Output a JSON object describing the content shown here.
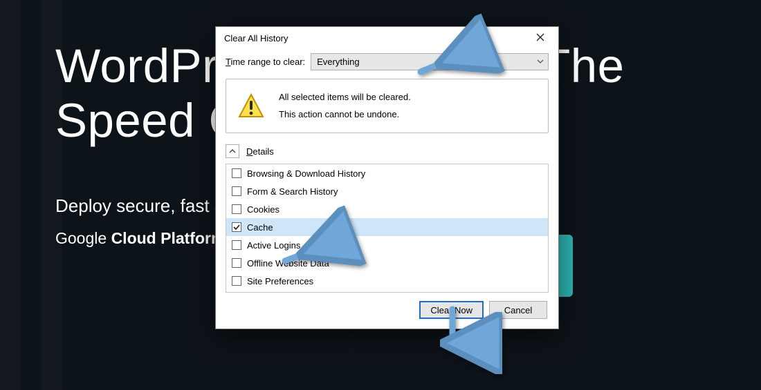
{
  "hero": {
    "title": "WordPress Hosting At The Speed Of",
    "subtitle": "Deploy secure, fast and reliable WordPress hosting",
    "platform_prefix": "Google",
    "platform_bold": "Cloud Platform"
  },
  "dialog": {
    "title": "Clear All History",
    "range_label_pre": "T",
    "range_label_rest": "ime range to clear:",
    "range_value": "Everything",
    "warn_line1": "All selected items will be cleared.",
    "warn_line2": "This action cannot be undone.",
    "details_pre": "D",
    "details_rest": "etails",
    "options": [
      {
        "label": "Browsing & Download History",
        "checked": false,
        "selected": false
      },
      {
        "label": "Form & Search History",
        "checked": false,
        "selected": false
      },
      {
        "label": "Cookies",
        "checked": false,
        "selected": false
      },
      {
        "label": "Cache",
        "checked": true,
        "selected": true
      },
      {
        "label": "Active Logins",
        "checked": false,
        "selected": false
      },
      {
        "label": "Offline Website Data",
        "checked": false,
        "selected": false
      },
      {
        "label": "Site Preferences",
        "checked": false,
        "selected": false
      }
    ],
    "primary_btn": "Clear Now",
    "cancel_btn": "Cancel"
  },
  "colors": {
    "arrow": "#6fa8d8",
    "arrow_stroke": "#5b8fbd"
  }
}
